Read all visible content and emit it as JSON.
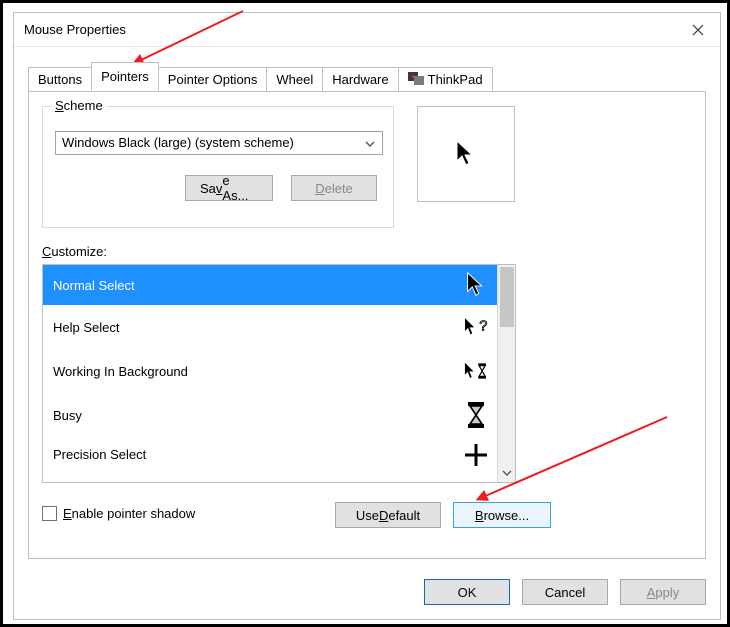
{
  "window": {
    "title": "Mouse Properties"
  },
  "tabs": [
    {
      "label": "Buttons"
    },
    {
      "label": "Pointers"
    },
    {
      "label": "Pointer Options"
    },
    {
      "label": "Wheel"
    },
    {
      "label": "Hardware"
    },
    {
      "label": "ThinkPad"
    }
  ],
  "scheme": {
    "legend_full": "Scheme",
    "legend_u": "S",
    "legend_rest": "cheme",
    "selected": "Windows Black (large) (system scheme)",
    "save_pre": "Sa",
    "save_u": "v",
    "save_post": "e As...",
    "delete_u": "D",
    "delete_post": "elete"
  },
  "customize": {
    "label_u": "C",
    "label_post": "ustomize:",
    "items": [
      {
        "name": "Normal Select",
        "icon": "cursor-arrow",
        "selected": true
      },
      {
        "name": "Help Select",
        "icon": "cursor-help"
      },
      {
        "name": "Working In Background",
        "icon": "cursor-busy-bg"
      },
      {
        "name": "Busy",
        "icon": "cursor-hourglass"
      },
      {
        "name": "Precision Select",
        "icon": "cursor-crosshair"
      }
    ]
  },
  "shadow": {
    "u": "E",
    "post": "nable pointer shadow"
  },
  "buttons": {
    "use_default_pre": "Use ",
    "use_default_u": "D",
    "use_default_post": "efault",
    "browse_u": "B",
    "browse_post": "rowse..."
  },
  "dialog": {
    "ok": "OK",
    "cancel": "Cancel",
    "apply_u": "A",
    "apply_post": "pply"
  }
}
